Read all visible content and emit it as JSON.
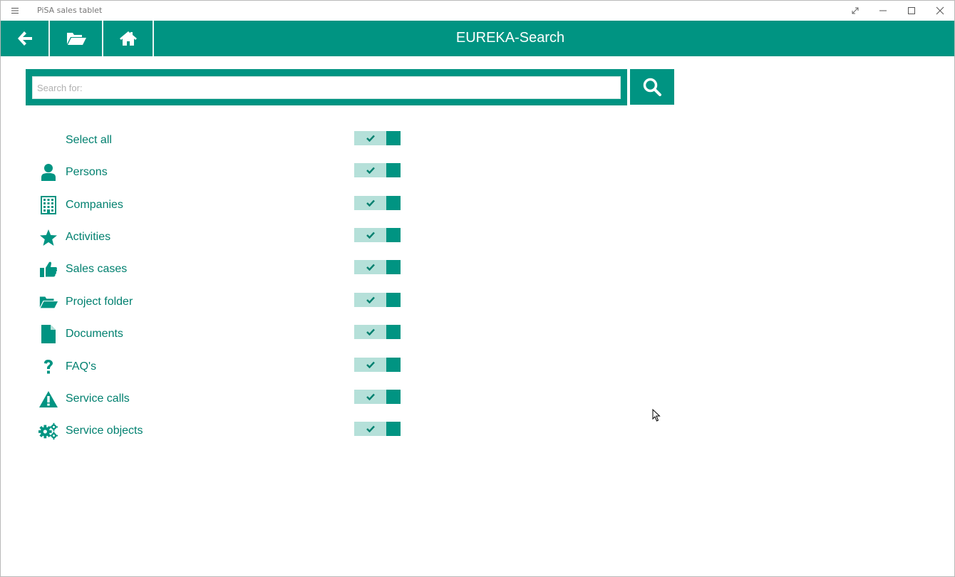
{
  "window": {
    "app_title": "PiSA sales tablet"
  },
  "header": {
    "title": "EUREKA-Search",
    "buttons": [
      {
        "icon": "arrow-left-icon"
      },
      {
        "icon": "folder-open-icon"
      },
      {
        "icon": "home-icon"
      }
    ]
  },
  "search": {
    "placeholder": "Search for:",
    "value": "",
    "button_icon": "magnifier-icon"
  },
  "filters": [
    {
      "label": "Select all",
      "icon": "",
      "checked": true
    },
    {
      "label": "Persons",
      "icon": "person-icon",
      "checked": true
    },
    {
      "label": "Companies",
      "icon": "building-icon",
      "checked": true
    },
    {
      "label": "Activities",
      "icon": "star-icon",
      "checked": true
    },
    {
      "label": "Sales cases",
      "icon": "thumbs-up-icon",
      "checked": true
    },
    {
      "label": "Project folder",
      "icon": "folder-open-icon",
      "checked": true
    },
    {
      "label": "Documents",
      "icon": "document-icon",
      "checked": true
    },
    {
      "label": "FAQ's",
      "icon": "question-icon",
      "checked": true
    },
    {
      "label": "Service calls",
      "icon": "warning-icon",
      "checked": true
    },
    {
      "label": "Service objects",
      "icon": "gears-icon",
      "checked": true
    }
  ],
  "colors": {
    "accent": "#009482",
    "accent_text": "#00806f",
    "toggle_track": "#b5e0d9"
  }
}
